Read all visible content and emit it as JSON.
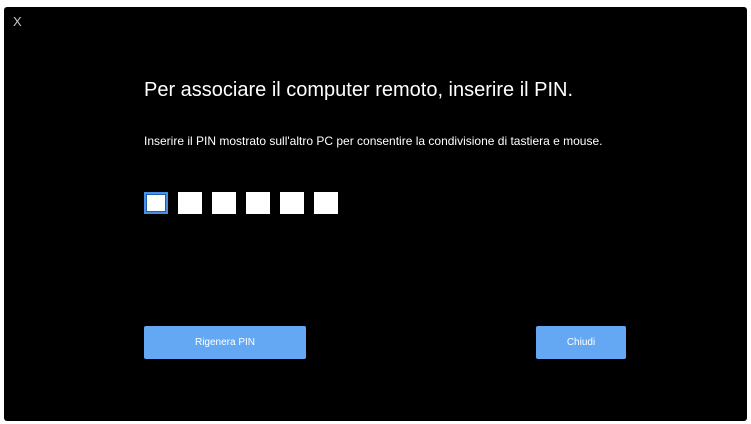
{
  "window": {
    "close_label": "X",
    "title": "Per associare il computer remoto, inserire il PIN.",
    "description": "Inserire il PIN mostrato sull'altro PC per consentire la condivisione di tastiera e mouse."
  },
  "pin": {
    "digits": [
      "",
      "",
      "",
      "",
      "",
      ""
    ]
  },
  "buttons": {
    "regenerate_label": "Rigenera PIN",
    "close_label": "Chiudi"
  },
  "colors": {
    "background": "#000000",
    "button": "#64a8f4",
    "pin_focus": "#4a8fe0"
  }
}
